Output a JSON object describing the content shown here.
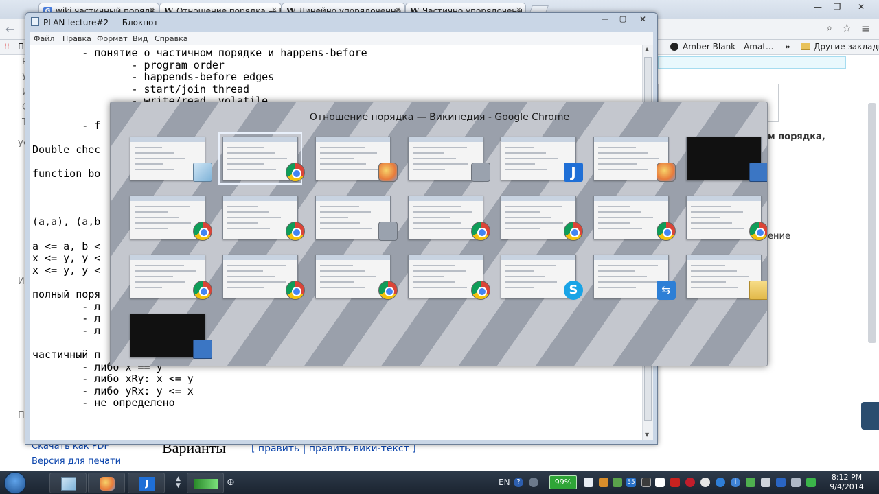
{
  "chrome": {
    "tabs": [
      {
        "label": "wiki частичный порядк",
        "favicon": "G"
      },
      {
        "label": "Отношение порядка — В",
        "favicon": "W"
      },
      {
        "label": "Линейно упорядоченно",
        "favicon": "W"
      },
      {
        "label": "Частично упорядоченн",
        "favicon": "W"
      }
    ],
    "bookmarks": [
      {
        "label": "Amber Blank - Amat..."
      },
      {
        "label": "»"
      },
      {
        "label": "Другие закладки"
      }
    ],
    "bookmarks_left_fragment": "Пр"
  },
  "wiki": {
    "left_fragments": [
      "Р",
      "У",
      "И",
      "С",
      "Т",
      "Уч",
      "Ин",
      "Пр"
    ],
    "sidebar_links": [
      "Скачать как PDF",
      "Версия для печати"
    ],
    "right_fragments": [
      "м порядка,",
      "ение"
    ],
    "section_heading": "Варианты",
    "section_links": "[ править | править вики-текст ]"
  },
  "notepad": {
    "title": "PLAN-lecture#2 — Блокнот",
    "menu": [
      "Файл",
      "Правка",
      "Формат",
      "Вид",
      "Справка"
    ],
    "lines": [
      "        - понятие о частичном порядке и happens-before",
      "                - program order",
      "                - happends-before edges",
      "                - start/join thread",
      "                - write/read, volatile",
      "",
      "        - f",
      "",
      "Double chec",
      "",
      "function bo",
      "",
      "",
      "",
      "(a,a), (a,b",
      "",
      "a <= a, b <",
      "x <= y, y <",
      "x <= y, y <",
      "",
      "полный поря",
      "        - л",
      "        - л",
      "        - л",
      "",
      "частичный п",
      "        - либо x == y",
      "        - либо xRy: x <= y",
      "        - либо yRx: y <= x",
      "        - не определено"
    ]
  },
  "switcher": {
    "title": "Отношение порядка — Википедия - Google Chrome",
    "thumbnails": [
      {
        "badge": "notepad-icon"
      },
      {
        "badge": "chrome-icon",
        "selected": true
      },
      {
        "badge": "paint-icon"
      },
      {
        "badge": "people-icon"
      },
      {
        "badge": "intellij-icon"
      },
      {
        "badge": "paint-icon"
      },
      {
        "badge": "screen-icon",
        "dark": true
      },
      {
        "badge": "chrome-icon"
      },
      {
        "badge": "chrome-icon"
      },
      {
        "badge": "people-icon"
      },
      {
        "badge": "chrome-icon"
      },
      {
        "badge": "chrome-icon"
      },
      {
        "badge": "chrome-icon"
      },
      {
        "badge": "chrome-icon"
      },
      {
        "badge": "chrome-icon"
      },
      {
        "badge": "chrome-icon"
      },
      {
        "badge": "chrome-icon"
      },
      {
        "badge": "chrome-icon"
      },
      {
        "badge": "skype-icon"
      },
      {
        "badge": "teamviewer-icon"
      },
      {
        "badge": "folder-icon"
      },
      {
        "badge": "terminal-icon",
        "dark": true
      }
    ]
  },
  "taskbar": {
    "language": "EN",
    "battery": "99%",
    "tray_badge": "55",
    "time": "8:12 PM",
    "date": "9/4/2014"
  }
}
